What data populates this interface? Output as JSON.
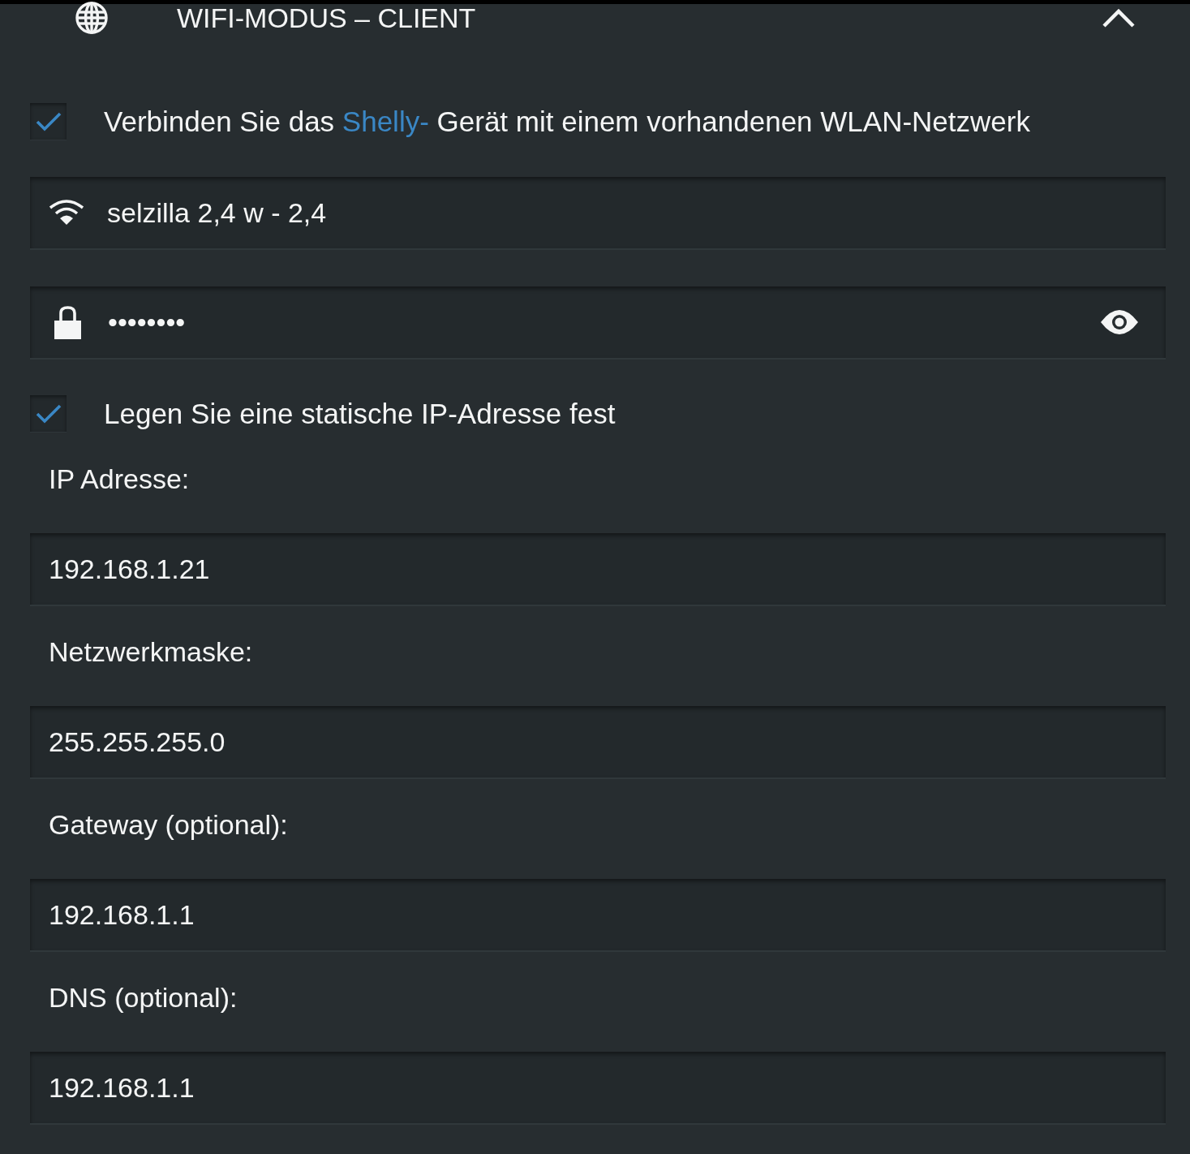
{
  "header": {
    "title": "WIFI-MODUS – CLIENT",
    "expanded": true
  },
  "connect_option": {
    "checked": true,
    "text_before": "Verbinden Sie das",
    "link": "Shelly-",
    "text_after": "Gerät mit einem vorhandenen WLAN-Netzwerk"
  },
  "wifi_network": {
    "value": "selzilla 2,4 w - 2,4"
  },
  "password": {
    "value": "••••••••"
  },
  "static_ip_option": {
    "checked": true,
    "label": "Legen Sie eine statische IP-Adresse fest"
  },
  "static_ip_fields": [
    {
      "label": "IP Adresse:",
      "value": "192.168.1.21"
    },
    {
      "label": "Netzwerkmaske:",
      "value": "255.255.255.0"
    },
    {
      "label": "Gateway (optional):",
      "value": "192.168.1.1"
    },
    {
      "label": "DNS (optional):",
      "value": "192.168.1.1"
    }
  ]
}
